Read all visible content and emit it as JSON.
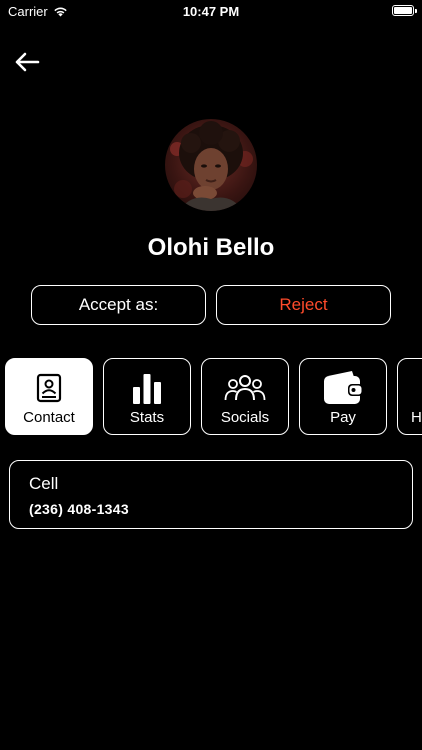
{
  "status_bar": {
    "carrier": "Carrier",
    "time": "10:47 PM"
  },
  "profile": {
    "name": "Olohi Bello"
  },
  "actions": {
    "accept_label": "Accept as:",
    "reject_label": "Reject",
    "reject_color": "#ff4b2b"
  },
  "tabs": [
    {
      "label": "Contact",
      "icon": "contact-book-icon",
      "active": true
    },
    {
      "label": "Stats",
      "icon": "bar-chart-icon",
      "active": false
    },
    {
      "label": "Socials",
      "icon": "people-icon",
      "active": false
    },
    {
      "label": "Pay",
      "icon": "wallet-icon",
      "active": false
    },
    {
      "label": "H",
      "icon": "",
      "active": false
    }
  ],
  "contact_card": {
    "label": "Cell",
    "value": "(236) 408-1343"
  }
}
